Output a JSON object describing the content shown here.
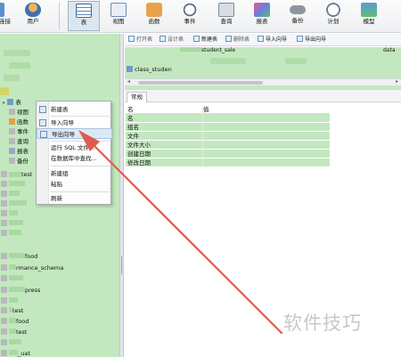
{
  "toolbar": {
    "items": [
      {
        "label": "连接",
        "icon": "connection-icon"
      },
      {
        "label": "用户",
        "icon": "user-icon"
      },
      {
        "label": "表",
        "icon": "table-icon",
        "active": true
      },
      {
        "label": "视图",
        "icon": "view-icon"
      },
      {
        "label": "函数",
        "icon": "function-icon"
      },
      {
        "label": "事件",
        "icon": "event-icon"
      },
      {
        "label": "查询",
        "icon": "query-icon"
      },
      {
        "label": "报表",
        "icon": "report-icon"
      },
      {
        "label": "备份",
        "icon": "backup-icon"
      },
      {
        "label": "计划",
        "icon": "schedule-icon"
      },
      {
        "label": "模型",
        "icon": "model-icon"
      }
    ]
  },
  "object_toolbar": {
    "buttons": [
      "打开表",
      "设计表",
      "新建表",
      "删除表",
      "导入向导",
      "导出向导"
    ]
  },
  "object_list": {
    "items": [
      "class_studen",
      "student_sale",
      "data"
    ]
  },
  "tree": {
    "rows": [
      "表",
      "视图",
      "函数",
      "事件",
      "查询",
      "报表",
      "备份",
      "test",
      "food",
      "rmance_schema",
      "press",
      "test",
      "food",
      "test",
      "_uat"
    ]
  },
  "context_menu": {
    "items": [
      "新建表",
      "导入向导",
      "导出向导",
      "运行 SQL 文件...",
      "在数据库中查找...",
      "新建组",
      "粘贴",
      "刷新"
    ]
  },
  "properties": {
    "tab": "常规",
    "headers": [
      "名",
      "值"
    ],
    "rows": [
      "名",
      "组名",
      "文件",
      "文件大小",
      "创建日期",
      "修改日期"
    ]
  },
  "watermark": "软件技巧",
  "colors": {
    "highlight_green": "#c3e8bf",
    "arrow_red": "#e05a4f",
    "menu_hover": "#dbe8f6"
  }
}
